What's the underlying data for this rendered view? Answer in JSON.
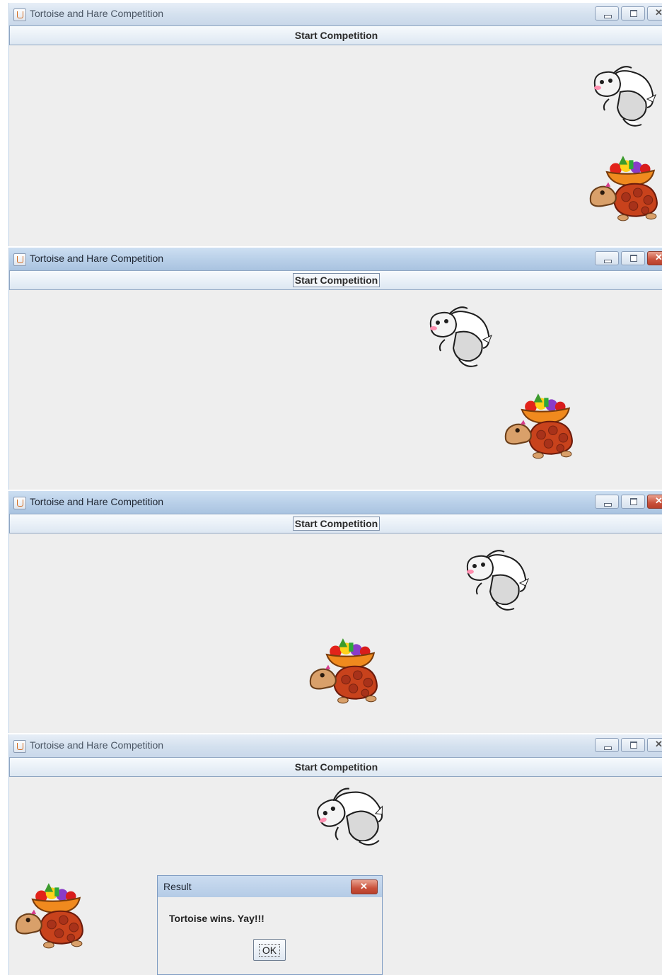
{
  "frames": [
    {
      "title": "Tortoise and Hare Competition",
      "button_label": "Start Competition",
      "window_state": "inactive"
    },
    {
      "title": "Tortoise and Hare Competition",
      "button_label": "Start Competition",
      "window_state": "active"
    },
    {
      "title": "Tortoise and Hare Competition",
      "button_label": "Start Competition",
      "window_state": "active"
    },
    {
      "title": "Tortoise and Hare Competition",
      "button_label": "Start Competition",
      "window_state": "inactive"
    }
  ],
  "dialog": {
    "title": "Result",
    "message": "Tortoise wins. Yay!!!",
    "ok_label": "OK"
  },
  "window_controls": {
    "minimize_icon": "minimize-icon",
    "maximize_icon": "maximize-icon",
    "close_icon": "close-icon"
  },
  "colors": {
    "window_bg": "#eeeeee",
    "titlebar_active": "#b8cfe8",
    "titlebar_inactive": "#d3e0ee",
    "close_active": "#c9513b",
    "tortoise_shell": "#c8421c",
    "tortoise_skin": "#d9a06a"
  }
}
